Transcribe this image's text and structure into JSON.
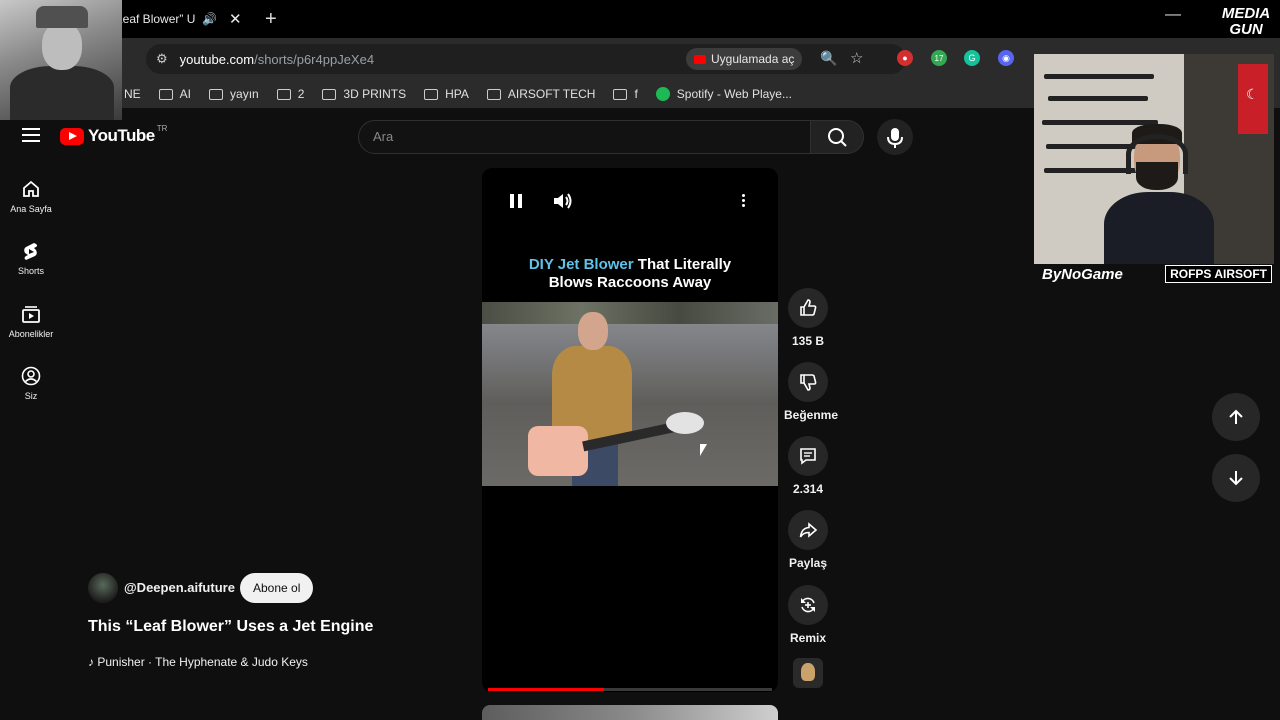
{
  "browser": {
    "tab_title": "“Leaf Blower” U",
    "url_host": "youtube.com",
    "url_path": "/shorts/p6r4ppJeXe4",
    "open_in_app": "Uygulamada aç",
    "extension_badge": "17",
    "bookmarks": [
      {
        "label": "NE",
        "icon": "none"
      },
      {
        "label": "AI",
        "icon": "folder-icon"
      },
      {
        "label": "yayın",
        "icon": "folder-icon"
      },
      {
        "label": "2",
        "icon": "folder-icon"
      },
      {
        "label": "3D PRINTS",
        "icon": "folder-icon"
      },
      {
        "label": "HPA",
        "icon": "folder-icon"
      },
      {
        "label": "AIRSOFT TECH",
        "icon": "folder-icon"
      },
      {
        "label": "f",
        "icon": "folder-icon"
      },
      {
        "label": "Spotify - Web Playe...",
        "icon": "spotify-icon"
      }
    ]
  },
  "overlay": {
    "media_logo": "MEDIA GUN",
    "streamer_name": "ByNoGame",
    "sponsor_left": "ROFPS",
    "sponsor_right": "AIRSOFT"
  },
  "youtube": {
    "logo_text": "YouTube",
    "country_code": "TR",
    "search_placeholder": "Ara",
    "nav": [
      {
        "label": "Ana Sayfa",
        "icon": "home-icon"
      },
      {
        "label": "Shorts",
        "icon": "shorts-icon"
      },
      {
        "label": "Abonelikler",
        "icon": "subscriptions-icon"
      },
      {
        "label": "Siz",
        "icon": "account-icon"
      }
    ]
  },
  "short": {
    "overlay_title_highlight": "DIY Jet Blower",
    "overlay_title_rest": " That Literally",
    "overlay_title_line2": "Blows Raccoons Away",
    "progress": 0.41,
    "actions": {
      "like": "135 B",
      "dislike": "Beğenme",
      "comments": "2.314",
      "share": "Paylaş",
      "remix": "Remix"
    },
    "channel": "@Deepen.aifuture",
    "subscribe_label": "Abone ol",
    "title": "This “Leaf Blower” Uses a Jet Engine",
    "music": "Punisher · The Hyphenate & Judo Keys"
  },
  "colors": {
    "accent_red": "#ff0000",
    "title_highlight": "#5fc2e8",
    "background": "#0f0f0f"
  }
}
